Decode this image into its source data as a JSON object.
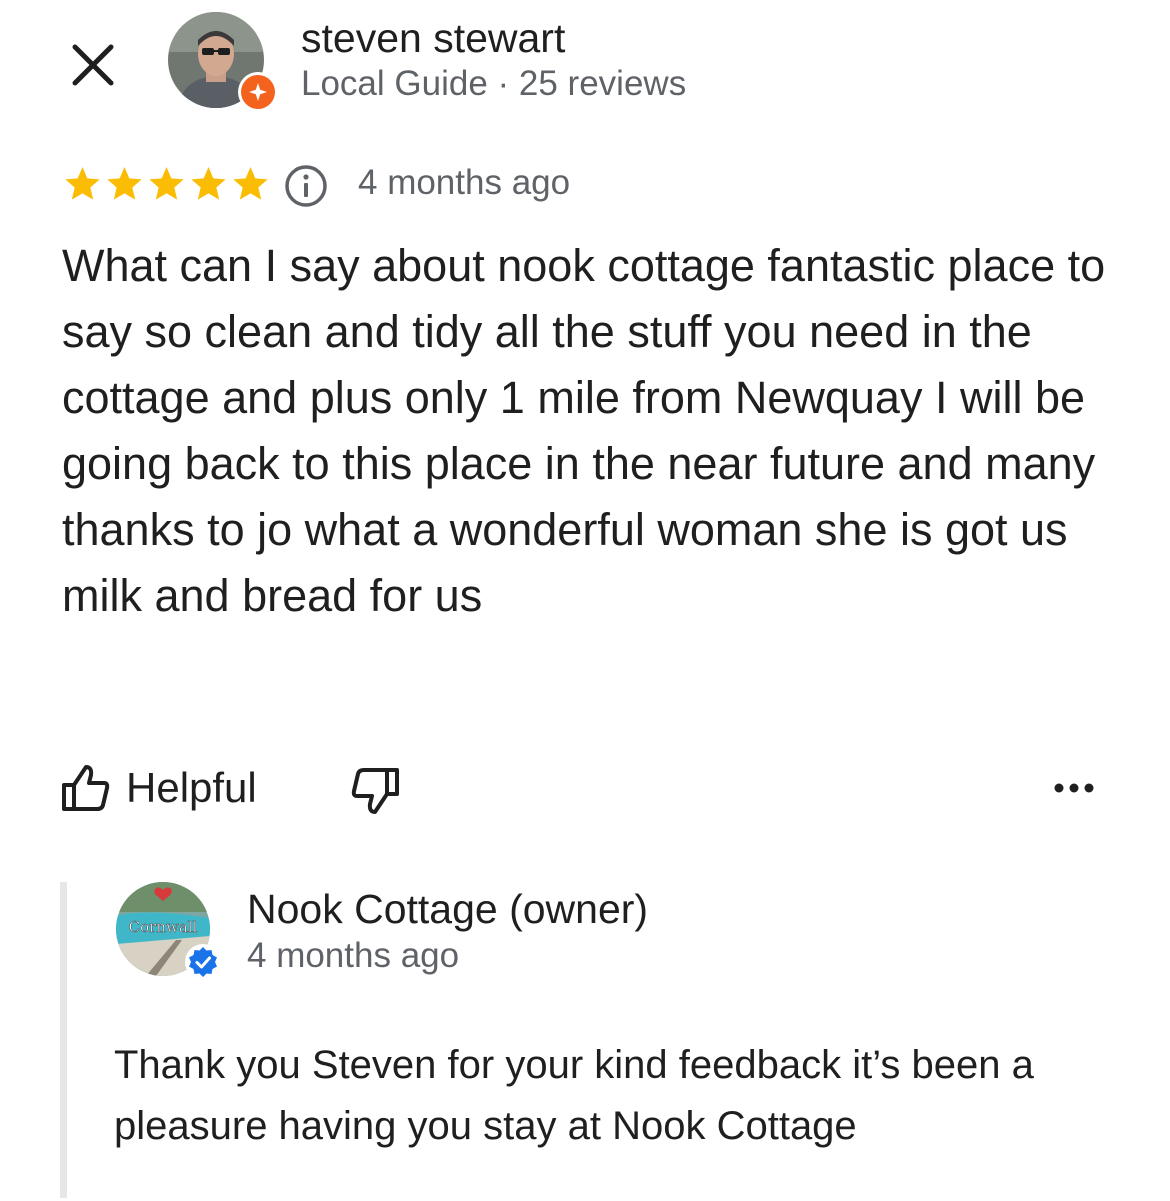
{
  "reviewer": {
    "name": "steven stewart",
    "meta": "Local Guide · 25 reviews",
    "is_local_guide": true
  },
  "review": {
    "rating": 5,
    "rating_max": 5,
    "age": "4 months ago",
    "text": "What can I say about nook cottage fantastic place to say so clean and tidy all the stuff you need in the cottage and plus only 1 mile from Newquay I will be going back to this place in the near future and many thanks to jo what a wonderful woman she is got us milk and bread for us"
  },
  "actions": {
    "helpful_label": "Helpful"
  },
  "owner_response": {
    "name": "Nook Cottage (owner)",
    "age": "4 months ago",
    "avatar_label": "Cornwall",
    "verified": true,
    "text": "Thank you Steven for your kind feedback it’s been a pleasure having you stay at Nook Cottage"
  },
  "icons": {
    "close": "close-icon",
    "info": "info-icon",
    "thumbs_up": "thumbs-up-icon",
    "thumbs_down": "thumbs-down-icon",
    "more": "more-horizontal-icon",
    "local_guide": "local-guide-badge-icon",
    "verified": "verified-check-icon"
  },
  "colors": {
    "star": "#fbbc04",
    "local_guide_badge": "#f4631e",
    "verified_badge": "#1a73e8",
    "secondary_text": "#5f6368",
    "primary_text": "#1f1f1f",
    "response_bar": "#e6e6e9"
  }
}
